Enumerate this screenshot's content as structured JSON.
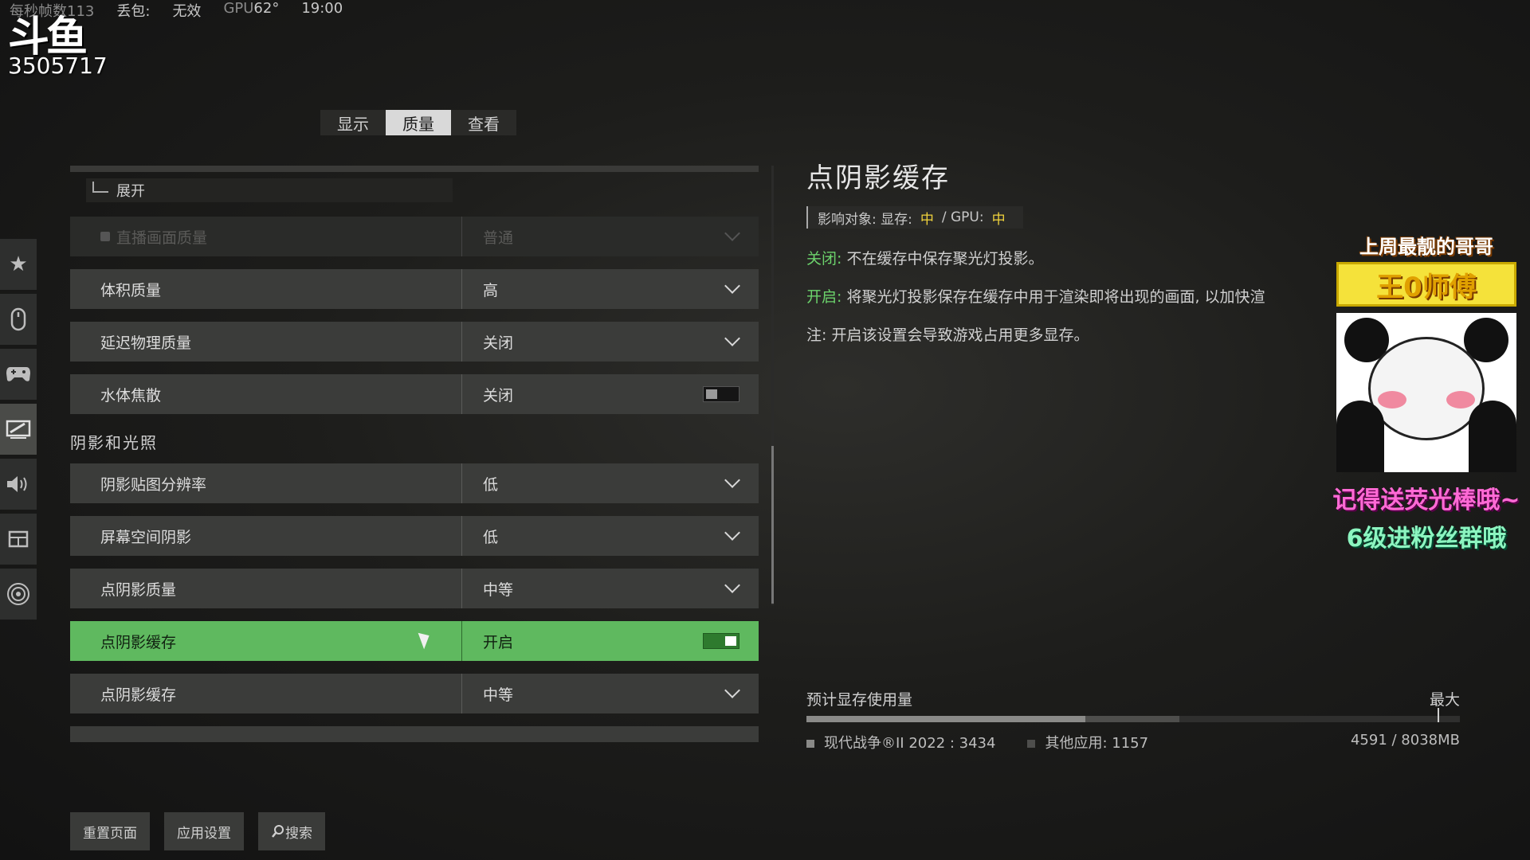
{
  "overlay": {
    "fps_label": "每秒帧数113",
    "drop_label": "丢包:",
    "drop_value": "无效",
    "gpu_label": "GPU",
    "gpu_value": "62°",
    "time": "19:00",
    "logo_text": "斗鱼",
    "room_id": "3505717"
  },
  "tabs": [
    {
      "label": "显示",
      "active": false
    },
    {
      "label": "质量",
      "active": true
    },
    {
      "label": "查看",
      "active": false
    }
  ],
  "sidebar": {
    "icons": [
      "star-icon",
      "mouse-icon",
      "gamepad-icon",
      "display-icon",
      "speaker-icon",
      "layout-icon",
      "network-icon"
    ],
    "active_index": 3
  },
  "settings": {
    "expand_label": "展开",
    "rows_upper": [
      {
        "name": "直播画面质量",
        "value": "普通",
        "control": "dropdown",
        "state": "disabled"
      },
      {
        "name": "体积质量",
        "value": "高",
        "control": "dropdown"
      },
      {
        "name": "延迟物理质量",
        "value": "关闭",
        "control": "dropdown"
      },
      {
        "name": "水体焦散",
        "value": "关闭",
        "control": "toggle-off"
      }
    ],
    "section_shadow": "阴影和光照",
    "rows_lower": [
      {
        "name": "阴影贴图分辨率",
        "value": "低",
        "control": "dropdown"
      },
      {
        "name": "屏幕空间阴影",
        "value": "低",
        "control": "dropdown"
      },
      {
        "name": "点阴影质量",
        "value": "中等",
        "control": "dropdown"
      },
      {
        "name": "点阴影缓存",
        "value": "开启",
        "control": "toggle-on",
        "state": "selected"
      },
      {
        "name": "点阴影缓存",
        "value": "中等",
        "control": "dropdown"
      }
    ]
  },
  "detail": {
    "title": "点阴影缓存",
    "impact_label": "影响对象: 显存:",
    "impact_vram": "中",
    "impact_gpu_label": "/ GPU:",
    "impact_gpu": "中",
    "off_label": "关闭:",
    "off_text": "不在缓存中保存聚光灯投影。",
    "on_label": "开启:",
    "on_text": "将聚光灯投影保存在缓存中用于渲染即将出现的画面, 以加快渲",
    "note": "注: 开启该设置会导致游戏占用更多显存。"
  },
  "vram": {
    "label": "预计显存使用量",
    "max_label": "最大",
    "game_label": "现代战争®II 2022 : 3434",
    "other_label": "其他应用: 1157",
    "total": "4591 / 8038MB",
    "game_mb": 3434,
    "other_mb": 1157,
    "capacity_mb": 8038,
    "colors": {
      "game": "#8a8a88",
      "other": "#4e4e4c"
    }
  },
  "buttons": {
    "reset": "重置页面",
    "apply": "应用设置",
    "search": "搜索"
  },
  "stream_overlay": {
    "badge_top": "上周最靓的哥哥",
    "badge_name": "王0师傅",
    "msg1": "记得送荧光棒哦~",
    "msg2": "6级进粉丝群哦"
  }
}
